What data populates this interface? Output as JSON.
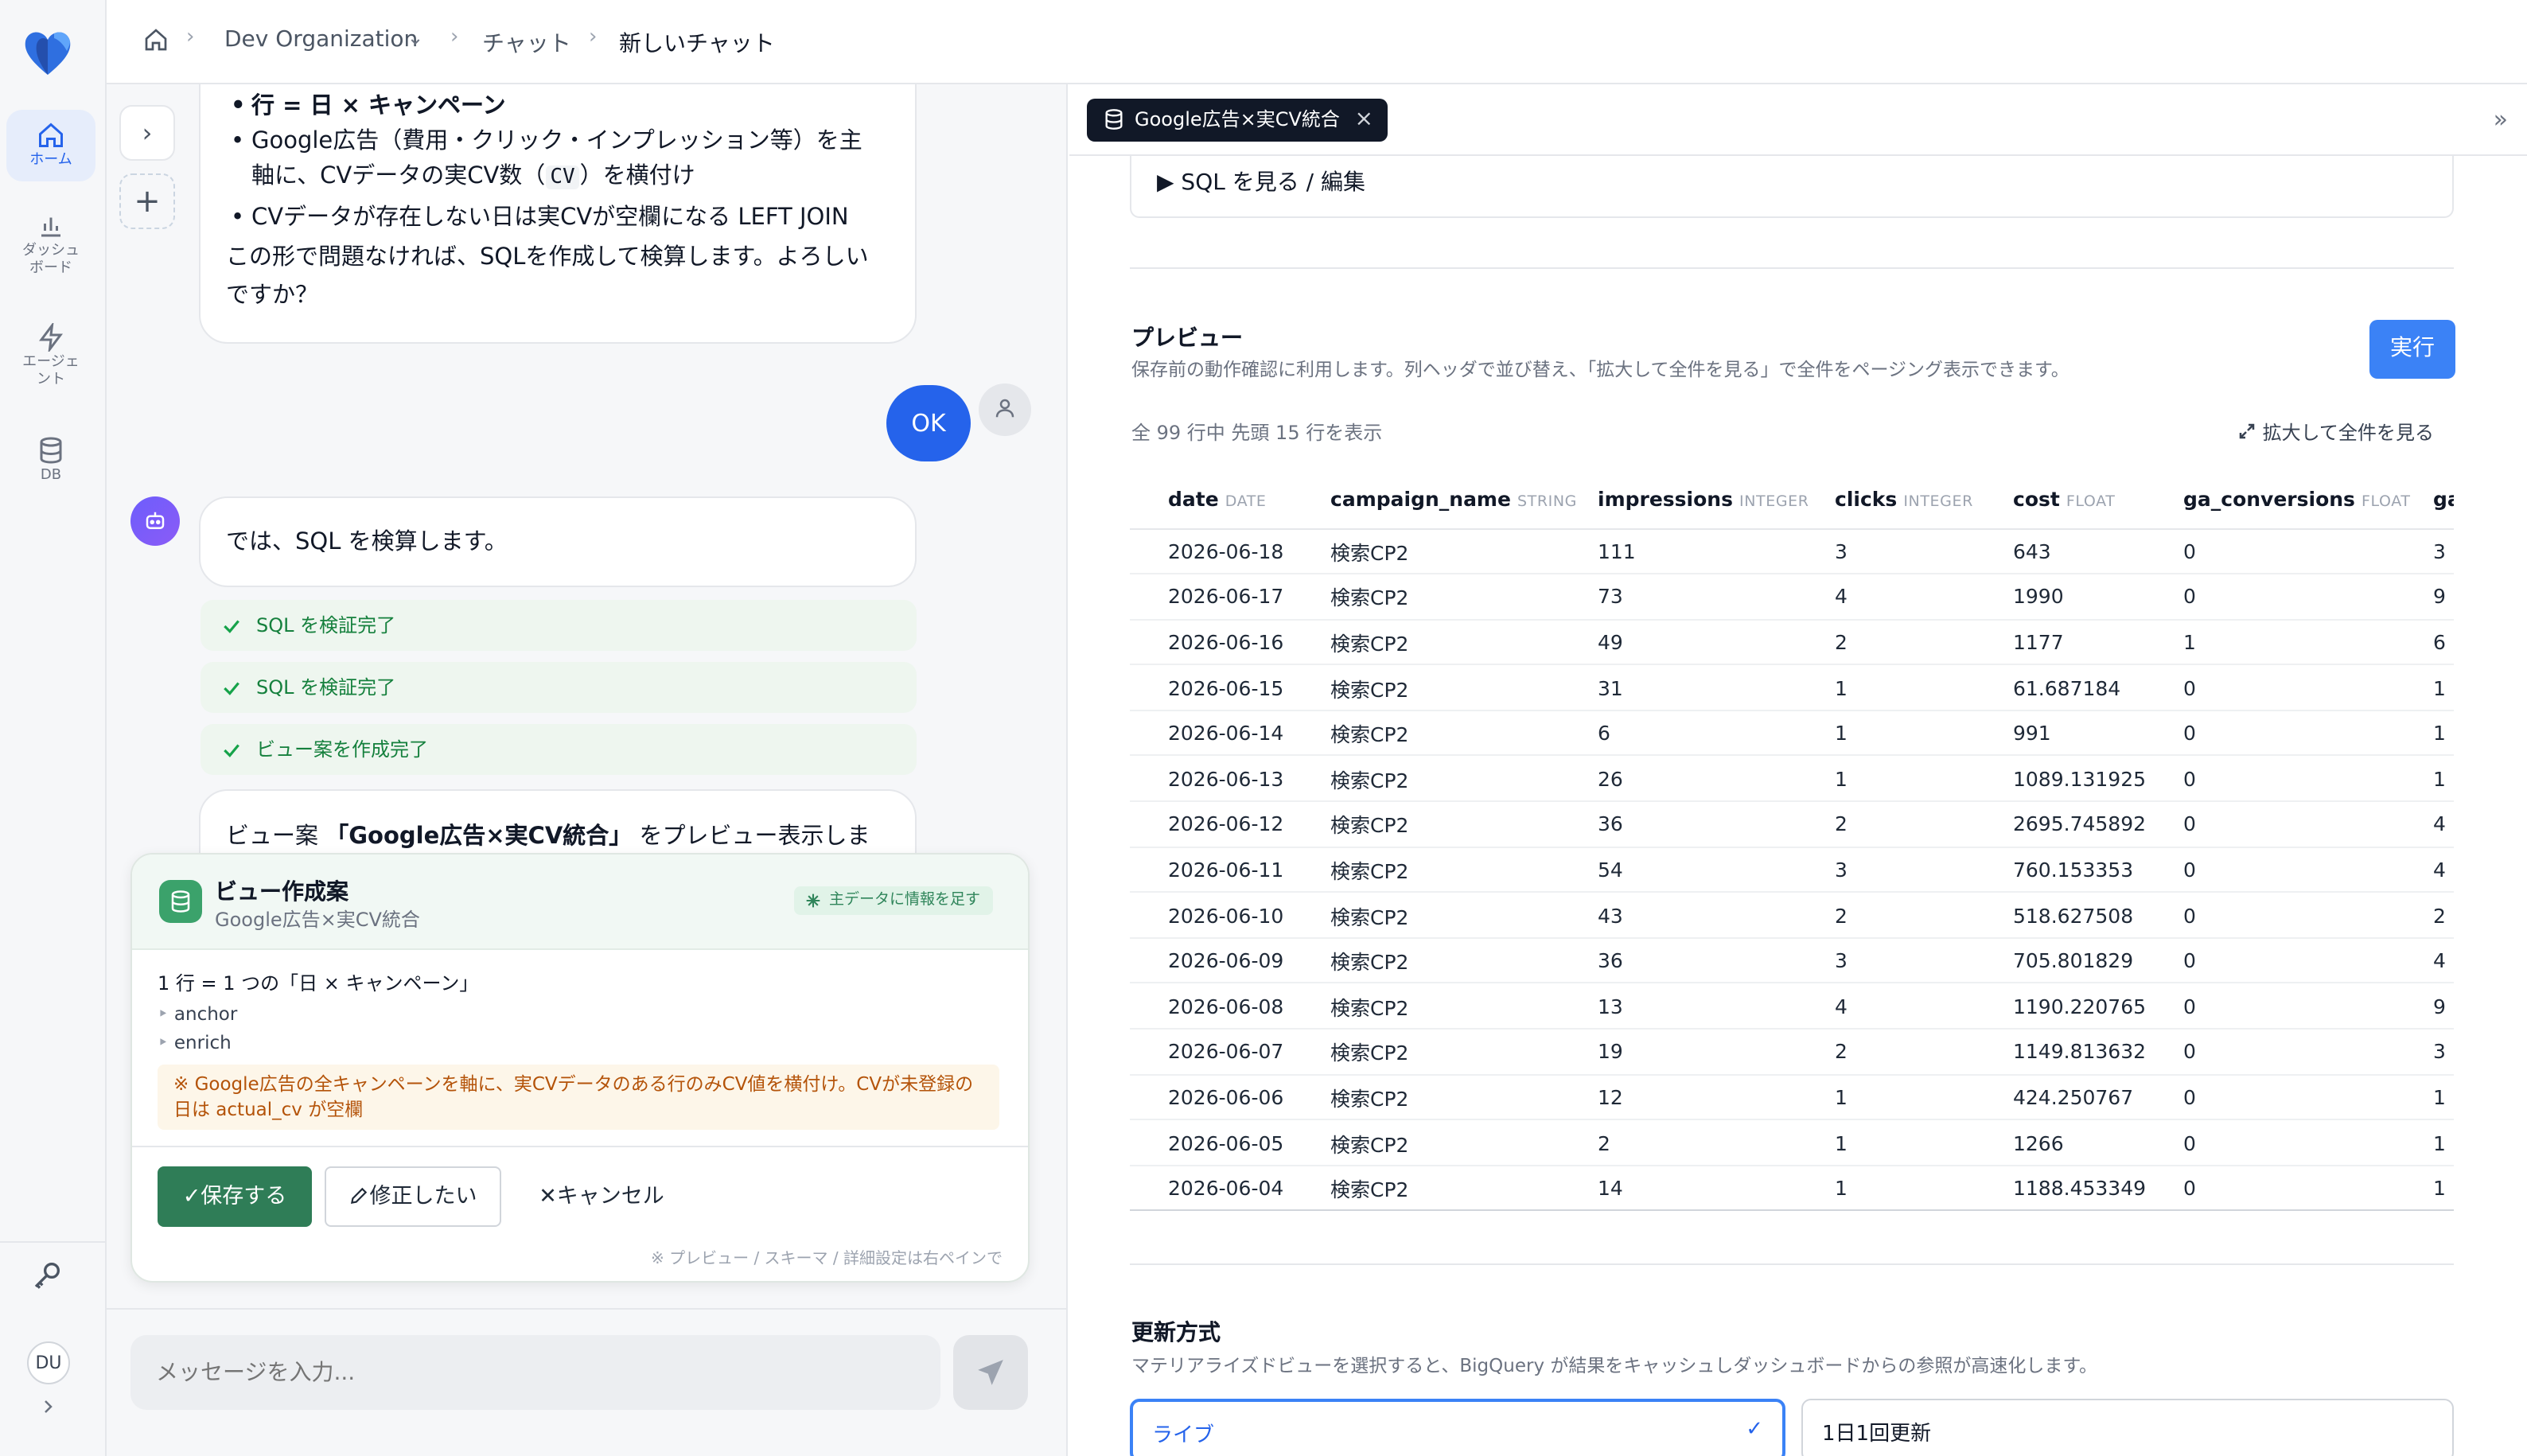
{
  "breadcrumb": {
    "org": "Dev Organization",
    "chat": "チャット",
    "current": "新しいチャット"
  },
  "rail": {
    "home": "ホーム",
    "dashboard_l1": "ダッシュ",
    "dashboard_l2": "ボード",
    "agent_l1": "エージェ",
    "agent_l2": "ント",
    "db": "DB",
    "user_initials": "DU"
  },
  "chat": {
    "prev_msg": {
      "item0": "行 = 日 × キャンペーン",
      "item1_a": "Google広告（費用・クリック・インプレッション等）を主",
      "item1_b": "軸に、CVデータの実CV数（",
      "item1_code": "CV",
      "item1_c": "）を横付け",
      "item2": "CVデータが存在しない日は実CVが空欄になる LEFT JOIN",
      "outro_a": "この形で問題なければ、SQLを作成して検算します。よろしい",
      "outro_b": "ですか？"
    },
    "user_reply": "OK",
    "bot_msg": "では、SQL を検算します。",
    "steps": [
      "SQL を検証完了",
      "SQL を検証完了",
      "ビュー案を作成完了"
    ],
    "partial_msg_a": "ビュー案 ",
    "partial_msg_b": "「Google広告×実CV統合」",
    "partial_msg_c": " をプレビュー表示しまし",
    "input_placeholder": "メッセージを入力..."
  },
  "proposal": {
    "title": "ビュー作成案",
    "subtitle": "Google広告×実CV統合",
    "badge": "主データに情報を足す",
    "grain": "1 行 = 1 つの「日 × キャンペーン」",
    "roles": [
      "anchor",
      "enrich"
    ],
    "note": "※ Google広告の全キャンペーンを軸に、実CVデータのある行のみCV値を横付け。CVが未登録の日は actual_cv が空欄",
    "save": "✓保存する",
    "edit": "修正したい",
    "cancel": "✕キャンセル",
    "footer": "※ プレビュー / スキーマ / 詳細設定は右ペインで"
  },
  "pane": {
    "tab_label": "Google広告×実CV統合",
    "sql_toggle": "▶ SQL を見る / 編集",
    "preview_title": "プレビュー",
    "preview_desc": "保存前の動作確認に利用します。列ヘッダで並び替え、「拡大して全件を見る」で全件をページング表示できます。",
    "run": "実行",
    "row_info": "全 99 行中 先頭 15 行を表示",
    "expand": "拡大して全件を見る",
    "columns": [
      {
        "name": "date",
        "type": "DATE"
      },
      {
        "name": "campaign_name",
        "type": "STRING"
      },
      {
        "name": "impressions",
        "type": "INTEGER"
      },
      {
        "name": "clicks",
        "type": "INTEGER"
      },
      {
        "name": "cost",
        "type": "FLOAT"
      },
      {
        "name": "ga_conversions",
        "type": "FLOAT"
      },
      {
        "name": "ga",
        "type": ""
      }
    ],
    "rows": [
      [
        "2026-06-18",
        "検索CP2",
        "111",
        "3",
        "643",
        "0",
        "3"
      ],
      [
        "2026-06-17",
        "検索CP2",
        "73",
        "4",
        "1990",
        "0",
        "9"
      ],
      [
        "2026-06-16",
        "検索CP2",
        "49",
        "2",
        "1177",
        "1",
        "6"
      ],
      [
        "2026-06-15",
        "検索CP2",
        "31",
        "1",
        "61.687184",
        "0",
        "1"
      ],
      [
        "2026-06-14",
        "検索CP2",
        "6",
        "1",
        "991",
        "0",
        "1"
      ],
      [
        "2026-06-13",
        "検索CP2",
        "26",
        "1",
        "1089.131925",
        "0",
        "1"
      ],
      [
        "2026-06-12",
        "検索CP2",
        "36",
        "2",
        "2695.745892",
        "0",
        "4"
      ],
      [
        "2026-06-11",
        "検索CP2",
        "54",
        "3",
        "760.153353",
        "0",
        "4"
      ],
      [
        "2026-06-10",
        "検索CP2",
        "43",
        "2",
        "518.627508",
        "0",
        "2"
      ],
      [
        "2026-06-09",
        "検索CP2",
        "36",
        "3",
        "705.801829",
        "0",
        "4"
      ],
      [
        "2026-06-08",
        "検索CP2",
        "13",
        "4",
        "1190.220765",
        "0",
        "9"
      ],
      [
        "2026-06-07",
        "検索CP2",
        "19",
        "2",
        "1149.813632",
        "0",
        "3"
      ],
      [
        "2026-06-06",
        "検索CP2",
        "12",
        "1",
        "424.250767",
        "0",
        "1"
      ],
      [
        "2026-06-05",
        "検索CP2",
        "2",
        "1",
        "1266",
        "0",
        "1"
      ],
      [
        "2026-06-04",
        "検索CP2",
        "14",
        "1",
        "1188.453349",
        "0",
        "1"
      ]
    ],
    "refresh_title": "更新方式",
    "refresh_desc": "マテリアライズドビューを選択すると、BigQuery が結果をキャッシュしダッシュボードからの参照が高速化します。",
    "refresh_options": [
      "ライブ",
      "1日1回更新"
    ]
  },
  "colors": {
    "accent": "#2563eb",
    "save_green": "#2f7d57",
    "run_blue": "#3b82f6",
    "note_bg": "#fdf6e9"
  }
}
